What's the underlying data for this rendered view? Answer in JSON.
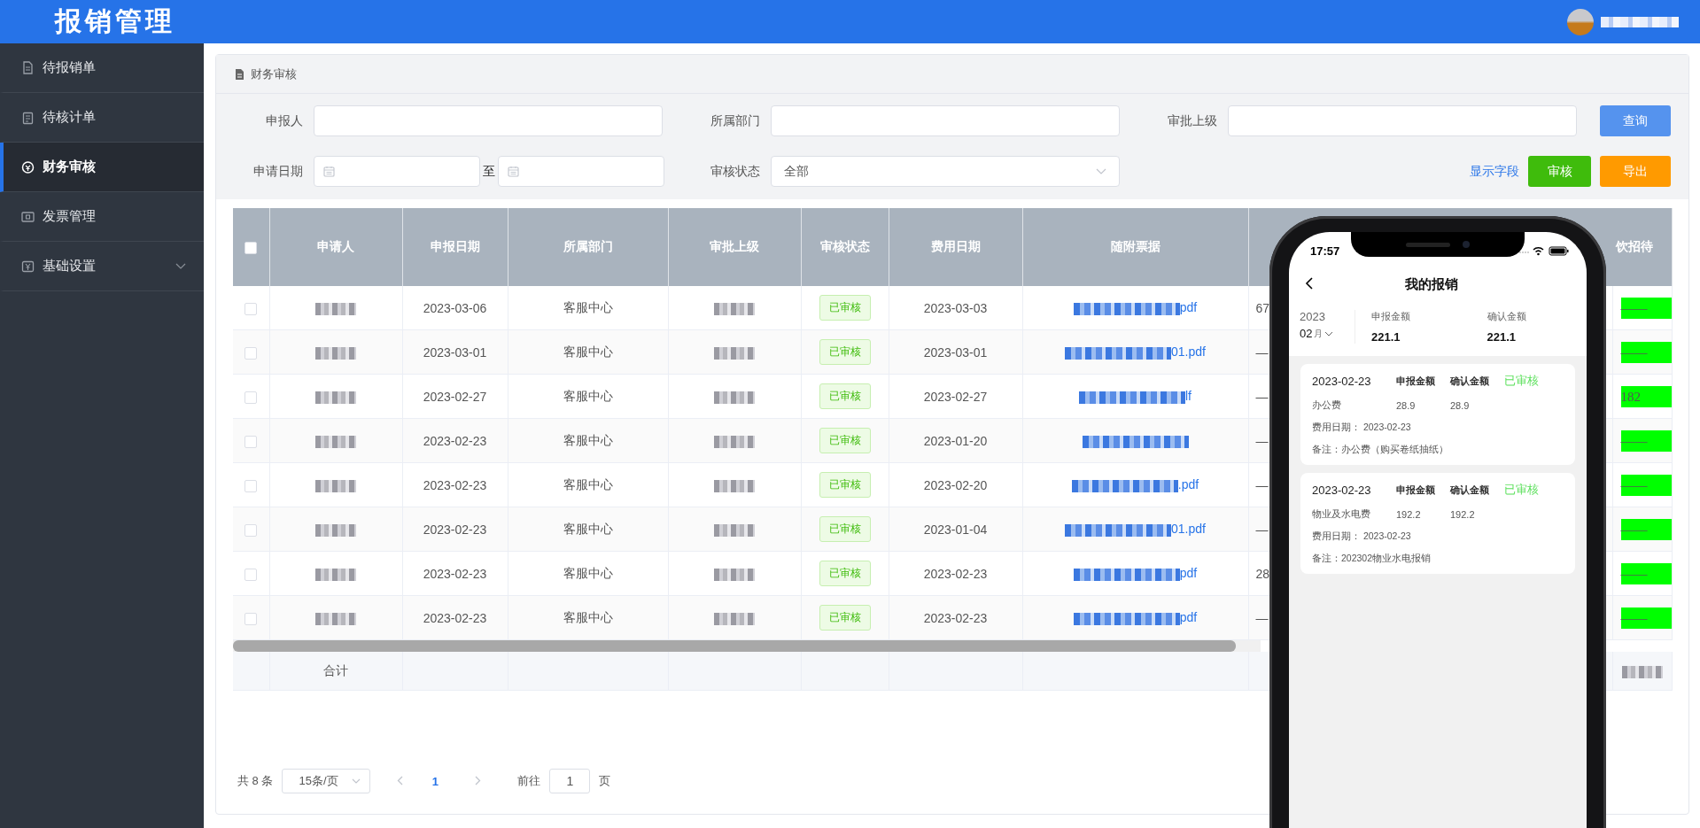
{
  "app": {
    "title": "报销管理"
  },
  "sidebar": {
    "items": [
      {
        "label": "待报销单",
        "selected": false,
        "expandable": false
      },
      {
        "label": "待核计单",
        "selected": false,
        "expandable": false
      },
      {
        "label": "财务审核",
        "selected": true,
        "expandable": false
      },
      {
        "label": "发票管理",
        "selected": false,
        "expandable": false
      },
      {
        "label": "基础设置",
        "selected": false,
        "expandable": true
      }
    ]
  },
  "panel": {
    "title": "财务审核"
  },
  "filters": {
    "applicant_label": "申报人",
    "department_label": "所属部门",
    "approver_label": "审批上级",
    "query_button": "查询",
    "date_label": "申请日期",
    "date_separator": "至",
    "status_label": "审核状态",
    "status_value": "全部",
    "fields_link": "显示字段",
    "approve_button": "审核",
    "export_button": "导出"
  },
  "table": {
    "select_all_checked": false,
    "columns": [
      "申请人",
      "申报日期",
      "所属部门",
      "审批上级",
      "审核状态",
      "费用日期",
      "随附票据"
    ],
    "last_column": "饮招待",
    "rows": [
      {
        "checked": false,
        "report_date": "2023-03-06",
        "department": "客服中心",
        "status": "已审核",
        "fee_date": "2023-03-03",
        "attachment_tail": "pdf",
        "column_9": "67",
        "last": "——"
      },
      {
        "checked": false,
        "report_date": "2023-03-01",
        "department": "客服中心",
        "status": "已审核",
        "fee_date": "2023-03-01",
        "attachment_tail": "01.pdf",
        "column_9": "—",
        "last": "——"
      },
      {
        "checked": false,
        "report_date": "2023-02-27",
        "department": "客服中心",
        "status": "已审核",
        "fee_date": "2023-02-27",
        "attachment_tail": "lf",
        "column_9": "—",
        "last": "182"
      },
      {
        "checked": false,
        "report_date": "2023-02-23",
        "department": "客服中心",
        "status": "已审核",
        "fee_date": "2023-01-20",
        "attachment_tail": "",
        "column_9": "—",
        "last": "——"
      },
      {
        "checked": false,
        "report_date": "2023-02-23",
        "department": "客服中心",
        "status": "已审核",
        "fee_date": "2023-02-20",
        "attachment_tail": ".pdf",
        "column_9": "—",
        "last": "——"
      },
      {
        "checked": false,
        "report_date": "2023-02-23",
        "department": "客服中心",
        "status": "已审核",
        "fee_date": "2023-01-04",
        "attachment_tail": "01.pdf",
        "column_9": "—",
        "last": "——"
      },
      {
        "checked": false,
        "report_date": "2023-02-23",
        "department": "客服中心",
        "status": "已审核",
        "fee_date": "2023-02-23",
        "attachment_tail": "pdf",
        "column_9": "28",
        "last": "——"
      },
      {
        "checked": false,
        "report_date": "2023-02-23",
        "department": "客服中心",
        "status": "已审核",
        "fee_date": "2023-02-23",
        "attachment_tail": "pdf",
        "column_9": "—",
        "last": "——"
      }
    ],
    "total_label": "合计"
  },
  "pagination": {
    "total": "共 8 条",
    "page_size": "15条/页",
    "pages": [
      {
        "label": "1",
        "selected": true
      }
    ],
    "goto_label": "前往",
    "goto_value": "1",
    "page_suffix": "页"
  },
  "phone": {
    "time": "17:57",
    "title": "我的报销",
    "year": "2023",
    "month": "02",
    "month_suffix": "月",
    "summary": [
      {
        "label": "申报金额",
        "value": "221.1"
      },
      {
        "label": "确认金额",
        "value": "221.1"
      }
    ],
    "cards": [
      {
        "date": "2023-02-23",
        "label_1": "申报金额",
        "label_2": "确认金额",
        "status": "已审核",
        "category": "办公费",
        "amount_1": "28.9",
        "amount_2": "28.9",
        "fee_date": "费用日期：  2023-02-23",
        "remark": "备注：办公费（购买卷纸抽纸）"
      },
      {
        "date": "2023-02-23",
        "label_1": "申报金额",
        "label_2": "确认金额",
        "status": "已审核",
        "category": "物业及水电费",
        "amount_1": "192.2",
        "amount_2": "192.2",
        "fee_date": "费用日期：  2023-02-23",
        "remark": "备注：202302物业水电报销"
      }
    ]
  }
}
